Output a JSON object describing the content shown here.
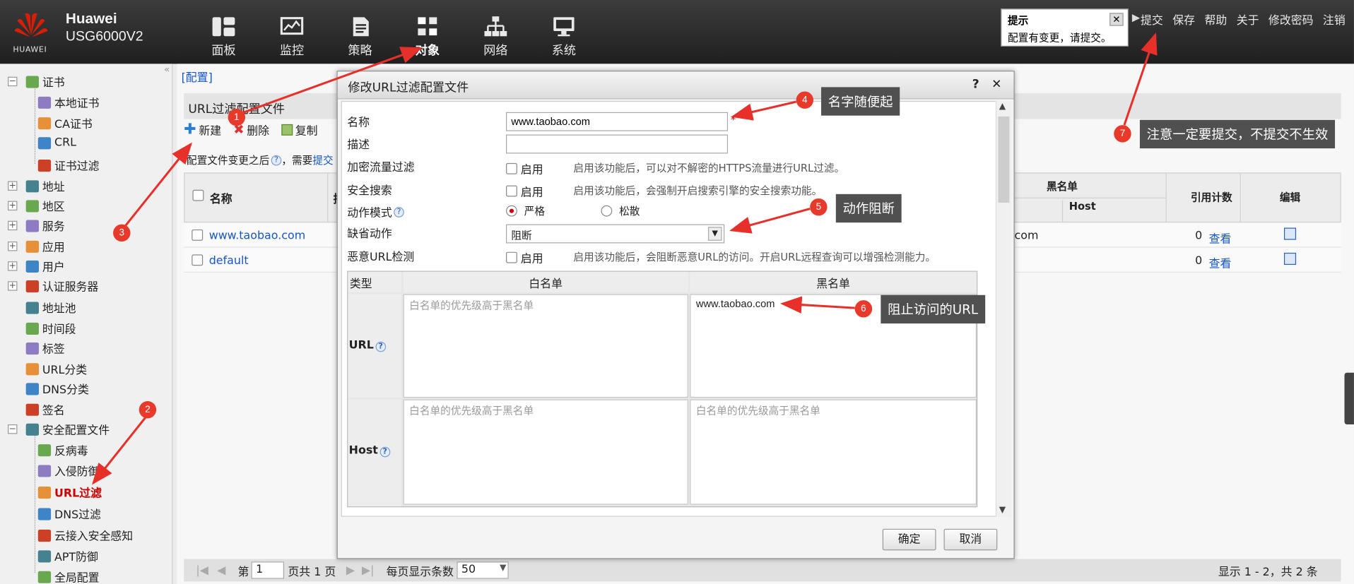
{
  "header": {
    "brand": "Huawei",
    "model": "USG6000V2",
    "logo_text": "HUAWEI",
    "nav": [
      {
        "label": "面板",
        "icon": "dashboard-icon"
      },
      {
        "label": "监控",
        "icon": "monitor-icon"
      },
      {
        "label": "策略",
        "icon": "policy-icon"
      },
      {
        "label": "对象",
        "icon": "object-icon"
      },
      {
        "label": "网络",
        "icon": "network-icon"
      },
      {
        "label": "系统",
        "icon": "system-icon"
      }
    ],
    "links": [
      "提交",
      "保存",
      "帮助",
      "关于",
      "修改密码",
      "注销"
    ],
    "tip": {
      "title": "提示",
      "text": "配置有变更，请提交。",
      "close": "✕"
    }
  },
  "sidebar": {
    "items": [
      {
        "label": "证书",
        "level": 0,
        "expander": "−"
      },
      {
        "label": "本地证书",
        "level": 1
      },
      {
        "label": "CA证书",
        "level": 1
      },
      {
        "label": "CRL",
        "level": 1
      },
      {
        "label": "证书过滤",
        "level": 1
      },
      {
        "label": "地址",
        "level": 0,
        "expander": "+"
      },
      {
        "label": "地区",
        "level": 0,
        "expander": "+"
      },
      {
        "label": "服务",
        "level": 0,
        "expander": "+"
      },
      {
        "label": "应用",
        "level": 0,
        "expander": "+"
      },
      {
        "label": "用户",
        "level": 0,
        "expander": "+"
      },
      {
        "label": "认证服务器",
        "level": 0,
        "expander": "+"
      },
      {
        "label": "地址池",
        "level": 0
      },
      {
        "label": "时间段",
        "level": 0
      },
      {
        "label": "标签",
        "level": 0
      },
      {
        "label": "URL分类",
        "level": 0
      },
      {
        "label": "DNS分类",
        "level": 0
      },
      {
        "label": "签名",
        "level": 0
      },
      {
        "label": "安全配置文件",
        "level": 0,
        "expander": "−"
      },
      {
        "label": "反病毒",
        "level": 1
      },
      {
        "label": "入侵防御",
        "level": 1
      },
      {
        "label": "URL过滤",
        "level": 1,
        "selected": true
      },
      {
        "label": "DNS过滤",
        "level": 1
      },
      {
        "label": "云接入安全感知",
        "level": 1
      },
      {
        "label": "APT防御",
        "level": 1
      },
      {
        "label": "全局配置",
        "level": 1
      }
    ]
  },
  "main": {
    "breadcrumb": "[配置]",
    "panel_title": "URL过滤配置文件",
    "toolbar": {
      "new": "新建",
      "delete": "删除",
      "copy": "复制"
    },
    "notice_prefix": "配置文件变更之后",
    "notice_mid": "，需要",
    "notice_link": "提交",
    "columns": {
      "name": "名称",
      "col2": "描",
      "blacklist": "黑名单",
      "host": "Host",
      "ref_count": "引用计数",
      "edit": "编辑"
    },
    "rows": [
      {
        "name": "www.taobao.com",
        "host": "o.com",
        "count": "0",
        "view": "查看"
      },
      {
        "name": "default",
        "host": "",
        "count": "0",
        "view": "查看"
      }
    ],
    "pager": {
      "page_prefix": "第",
      "page": "1",
      "page_suffix": "页共 1 页",
      "per_page_label": "每页显示条数",
      "per_page": "50",
      "summary": "显示 1 - 2，共 2 条"
    }
  },
  "dialog": {
    "title": "修改URL过滤配置文件",
    "help": "?",
    "close": "✕",
    "fields": {
      "name_label": "名称",
      "name_value": "www.taobao.com",
      "required_mark": "*",
      "desc_label": "描述",
      "desc_value": "",
      "https_label": "加密流量过滤",
      "https_check": "启用",
      "https_hint": "启用该功能后，可以对不解密的HTTPS流量进行URL过滤。",
      "safe_label": "安全搜索",
      "safe_check": "启用",
      "safe_hint": "启用该功能后，会强制开启搜索引擎的安全搜索功能。",
      "mode_label": "动作模式",
      "mode_strict": "严格",
      "mode_loose": "松散",
      "mode_selected": "严格",
      "default_action_label": "缺省动作",
      "default_action_value": "阻断",
      "malicious_label": "恶意URL检测",
      "malicious_check": "启用",
      "malicious_hint": "启用该功能后，会阻断恶意URL的访问。开启URL远程查询可以增强检测能力。"
    },
    "grid": {
      "type_header": "类型",
      "white_header": "白名单",
      "black_header": "黑名单",
      "url_label": "URL",
      "host_label": "Host",
      "white_placeholder": "白名单的优先级高于黑名单",
      "url_black_value": "www.taobao.com",
      "host_black_placeholder": "白名单的优先级高于黑名单"
    },
    "buttons": {
      "ok": "确定",
      "cancel": "取消"
    }
  },
  "annotations": [
    {
      "num": "1",
      "text": ""
    },
    {
      "num": "2",
      "text": ""
    },
    {
      "num": "3",
      "text": ""
    },
    {
      "num": "4",
      "text": "名字随便起"
    },
    {
      "num": "5",
      "text": "动作阻断"
    },
    {
      "num": "6",
      "text": "阻止访问的URL"
    },
    {
      "num": "7",
      "text": "注意一定要提交，不提交不生效"
    }
  ],
  "colors": {
    "topbar": "#2b2b2b",
    "accent_red": "#e83a2a",
    "link": "#1656c7",
    "callout": "#505050"
  }
}
